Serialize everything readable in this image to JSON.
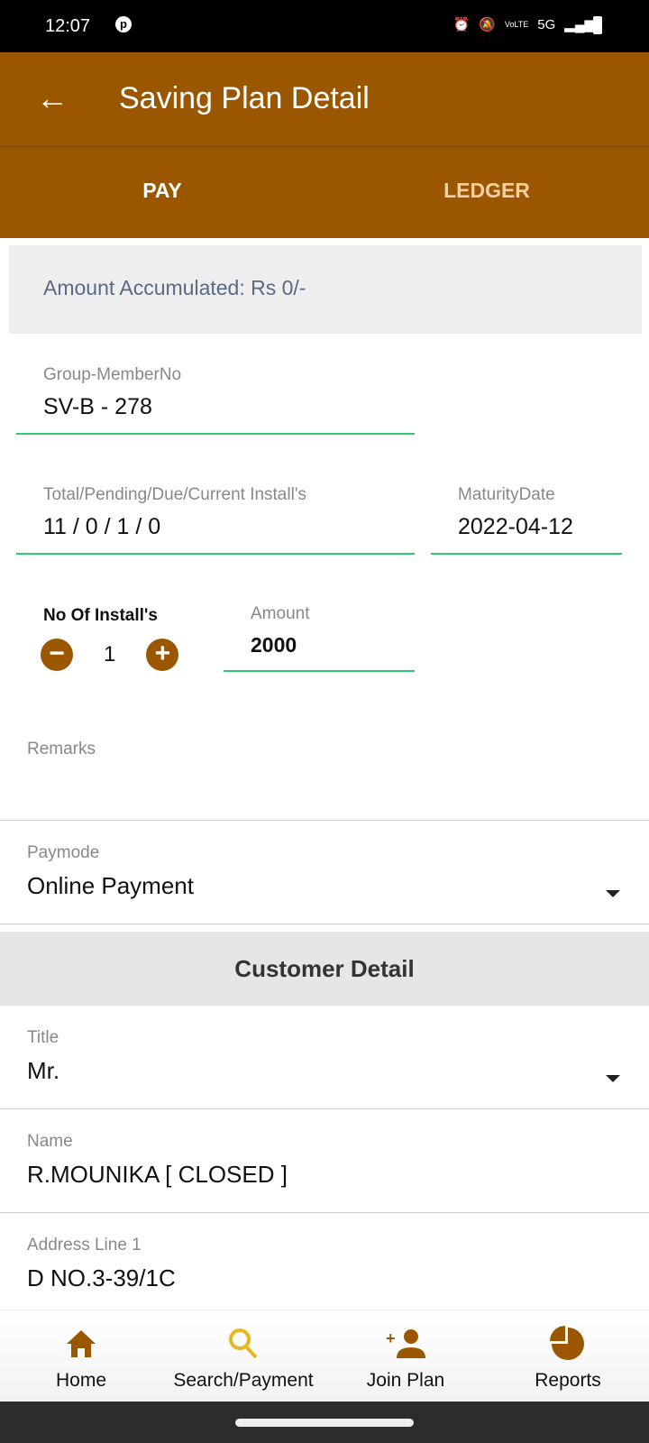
{
  "status_bar": {
    "time": "12:07",
    "icons": [
      "pinterest-icon",
      "alarm-icon",
      "bell-off-icon",
      "volte-icon",
      "signal-icon",
      "battery-icon"
    ],
    "network": "5G",
    "volte": "VoLTE"
  },
  "app_bar": {
    "title": "Saving Plan Detail",
    "back_icon": "arrow-left-icon"
  },
  "tabs": [
    {
      "label": "PAY",
      "active": true
    },
    {
      "label": "LEDGER",
      "active": false
    }
  ],
  "amount_accumulated": "Amount Accumulated: Rs 0/-",
  "form": {
    "group_member": {
      "label": "Group-MemberNo",
      "value": "SV-B - 278"
    },
    "installs": {
      "label": "Total/Pending/Due/Current Install's",
      "value": "11 / 0 / 1 / 0"
    },
    "maturity": {
      "label": "MaturityDate",
      "value": "2022-04-12"
    },
    "no_of_installs": {
      "label": "No Of Install's",
      "value": "1",
      "minus": "−",
      "plus": "+"
    },
    "amount": {
      "label": "Amount",
      "value": "2000"
    },
    "remarks": {
      "label": "Remarks",
      "value": ""
    },
    "paymode": {
      "label": "Paymode",
      "value": "Online Payment"
    }
  },
  "customer": {
    "heading": "Customer Detail",
    "title": {
      "label": "Title",
      "value": "Mr."
    },
    "name": {
      "label": "Name",
      "value": "R.MOUNIKA [ CLOSED ]"
    },
    "address1": {
      "label": "Address Line 1",
      "value": "D NO.3-39/1C"
    }
  },
  "bottom_nav": [
    {
      "label": "Home",
      "icon": "home-icon"
    },
    {
      "label": "Search/Payment",
      "icon": "search-icon",
      "active": true
    },
    {
      "label": "Join Plan",
      "icon": "add-user-icon"
    },
    {
      "label": "Reports",
      "icon": "pie-chart-icon"
    }
  ],
  "colors": {
    "primary": "#9a5700",
    "accent_active": "#e8b820",
    "underline": "#2ecc71"
  }
}
